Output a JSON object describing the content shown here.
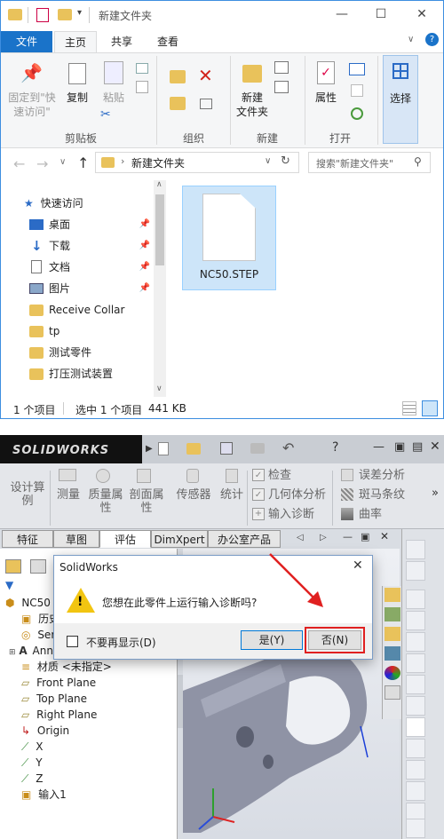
{
  "explorer": {
    "title": "新建文件夹",
    "tabs": [
      "文件",
      "主页",
      "共享",
      "查看"
    ],
    "ribbon": {
      "pin_label": "固定到\"快\n速访问\"",
      "copy": "复制",
      "paste": "粘贴",
      "clipboard_group": "剪贴板",
      "organize_group": "组织",
      "new_folder": "新建\n文件夹",
      "new_group": "新建",
      "properties": "属性",
      "open_group": "打开",
      "select": "选择"
    },
    "address": "新建文件夹",
    "search_placeholder": "搜索\"新建文件夹\"",
    "nav": {
      "quick_access": "快速访问",
      "items": [
        "桌面",
        "下载",
        "文档",
        "图片",
        "Receive Collar",
        "tp",
        "测试零件",
        "打压测试装置"
      ]
    },
    "file": {
      "name": "NC50.STEP"
    },
    "status": {
      "count": "1 个项目",
      "selected": "选中 1 个项目",
      "size": "441 KB"
    }
  },
  "solidworks": {
    "logo": "SOLIDWORKS",
    "toolbar": {
      "design_study": "设计算\n例",
      "measure": "测量",
      "mass_props": "质量属\n性",
      "section_props": "剖面属\n性",
      "sensor": "传感器",
      "statistics": "统计",
      "check": "检查",
      "geometry_analysis": "几何体分析",
      "import_diagnostics": "输入诊断",
      "deviation_analysis": "误差分析",
      "zebra": "斑马条纹",
      "curvature": "曲率"
    },
    "tabs": [
      "特征",
      "草图",
      "评估",
      "DimXpert",
      "办公室产品"
    ],
    "tree": {
      "root": "NC50",
      "items": [
        "历史",
        "Ser",
        "Ann",
        "材质 <未指定>",
        "Front Plane",
        "Top Plane",
        "Right Plane",
        "Origin",
        "X",
        "Y",
        "Z",
        "输入1"
      ]
    },
    "dialog": {
      "title": "SolidWorks",
      "message": "您想在此零件上运行输入诊断吗?",
      "checkbox": "不要再显示(D)",
      "yes": "是(Y)",
      "no": "否(N)"
    },
    "highlight_color": "#e02020"
  }
}
